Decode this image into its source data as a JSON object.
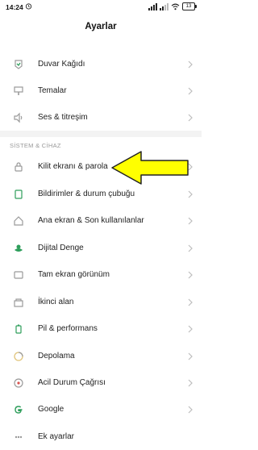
{
  "status_bar": {
    "time": "14:24",
    "battery": "13"
  },
  "header": {
    "title": "Ayarlar"
  },
  "section": {
    "label": "SİSTEM & CİHAZ"
  },
  "items": [
    {
      "label": "Duvar Kağıdı",
      "icon": "wallpaper-icon"
    },
    {
      "label": "Temalar",
      "icon": "themes-icon"
    },
    {
      "label": "Ses & titreşim",
      "icon": "sound-icon"
    },
    {
      "label": "Kilit ekranı & parola",
      "icon": "lock-icon"
    },
    {
      "label": "Bildirimler & durum çubuğu",
      "icon": "notifications-icon"
    },
    {
      "label": "Ana ekran & Son kullanılanlar",
      "icon": "home-icon"
    },
    {
      "label": "Dijital Denge",
      "icon": "digital-wellbeing-icon"
    },
    {
      "label": "Tam ekran görünüm",
      "icon": "fullscreen-icon"
    },
    {
      "label": "İkinci alan",
      "icon": "second-space-icon"
    },
    {
      "label": "Pil & performans",
      "icon": "battery-icon"
    },
    {
      "label": "Depolama",
      "icon": "storage-icon"
    },
    {
      "label": "Acil Durum Çağrısı",
      "icon": "sos-icon"
    },
    {
      "label": "Google",
      "icon": "google-icon"
    },
    {
      "label": "Ek ayarlar",
      "icon": "more-settings-icon"
    }
  ],
  "colors": {
    "highlight_arrow": "#ffff00",
    "icon_gray": "#9a9a9a",
    "accent_green": "#2e9e5b"
  }
}
